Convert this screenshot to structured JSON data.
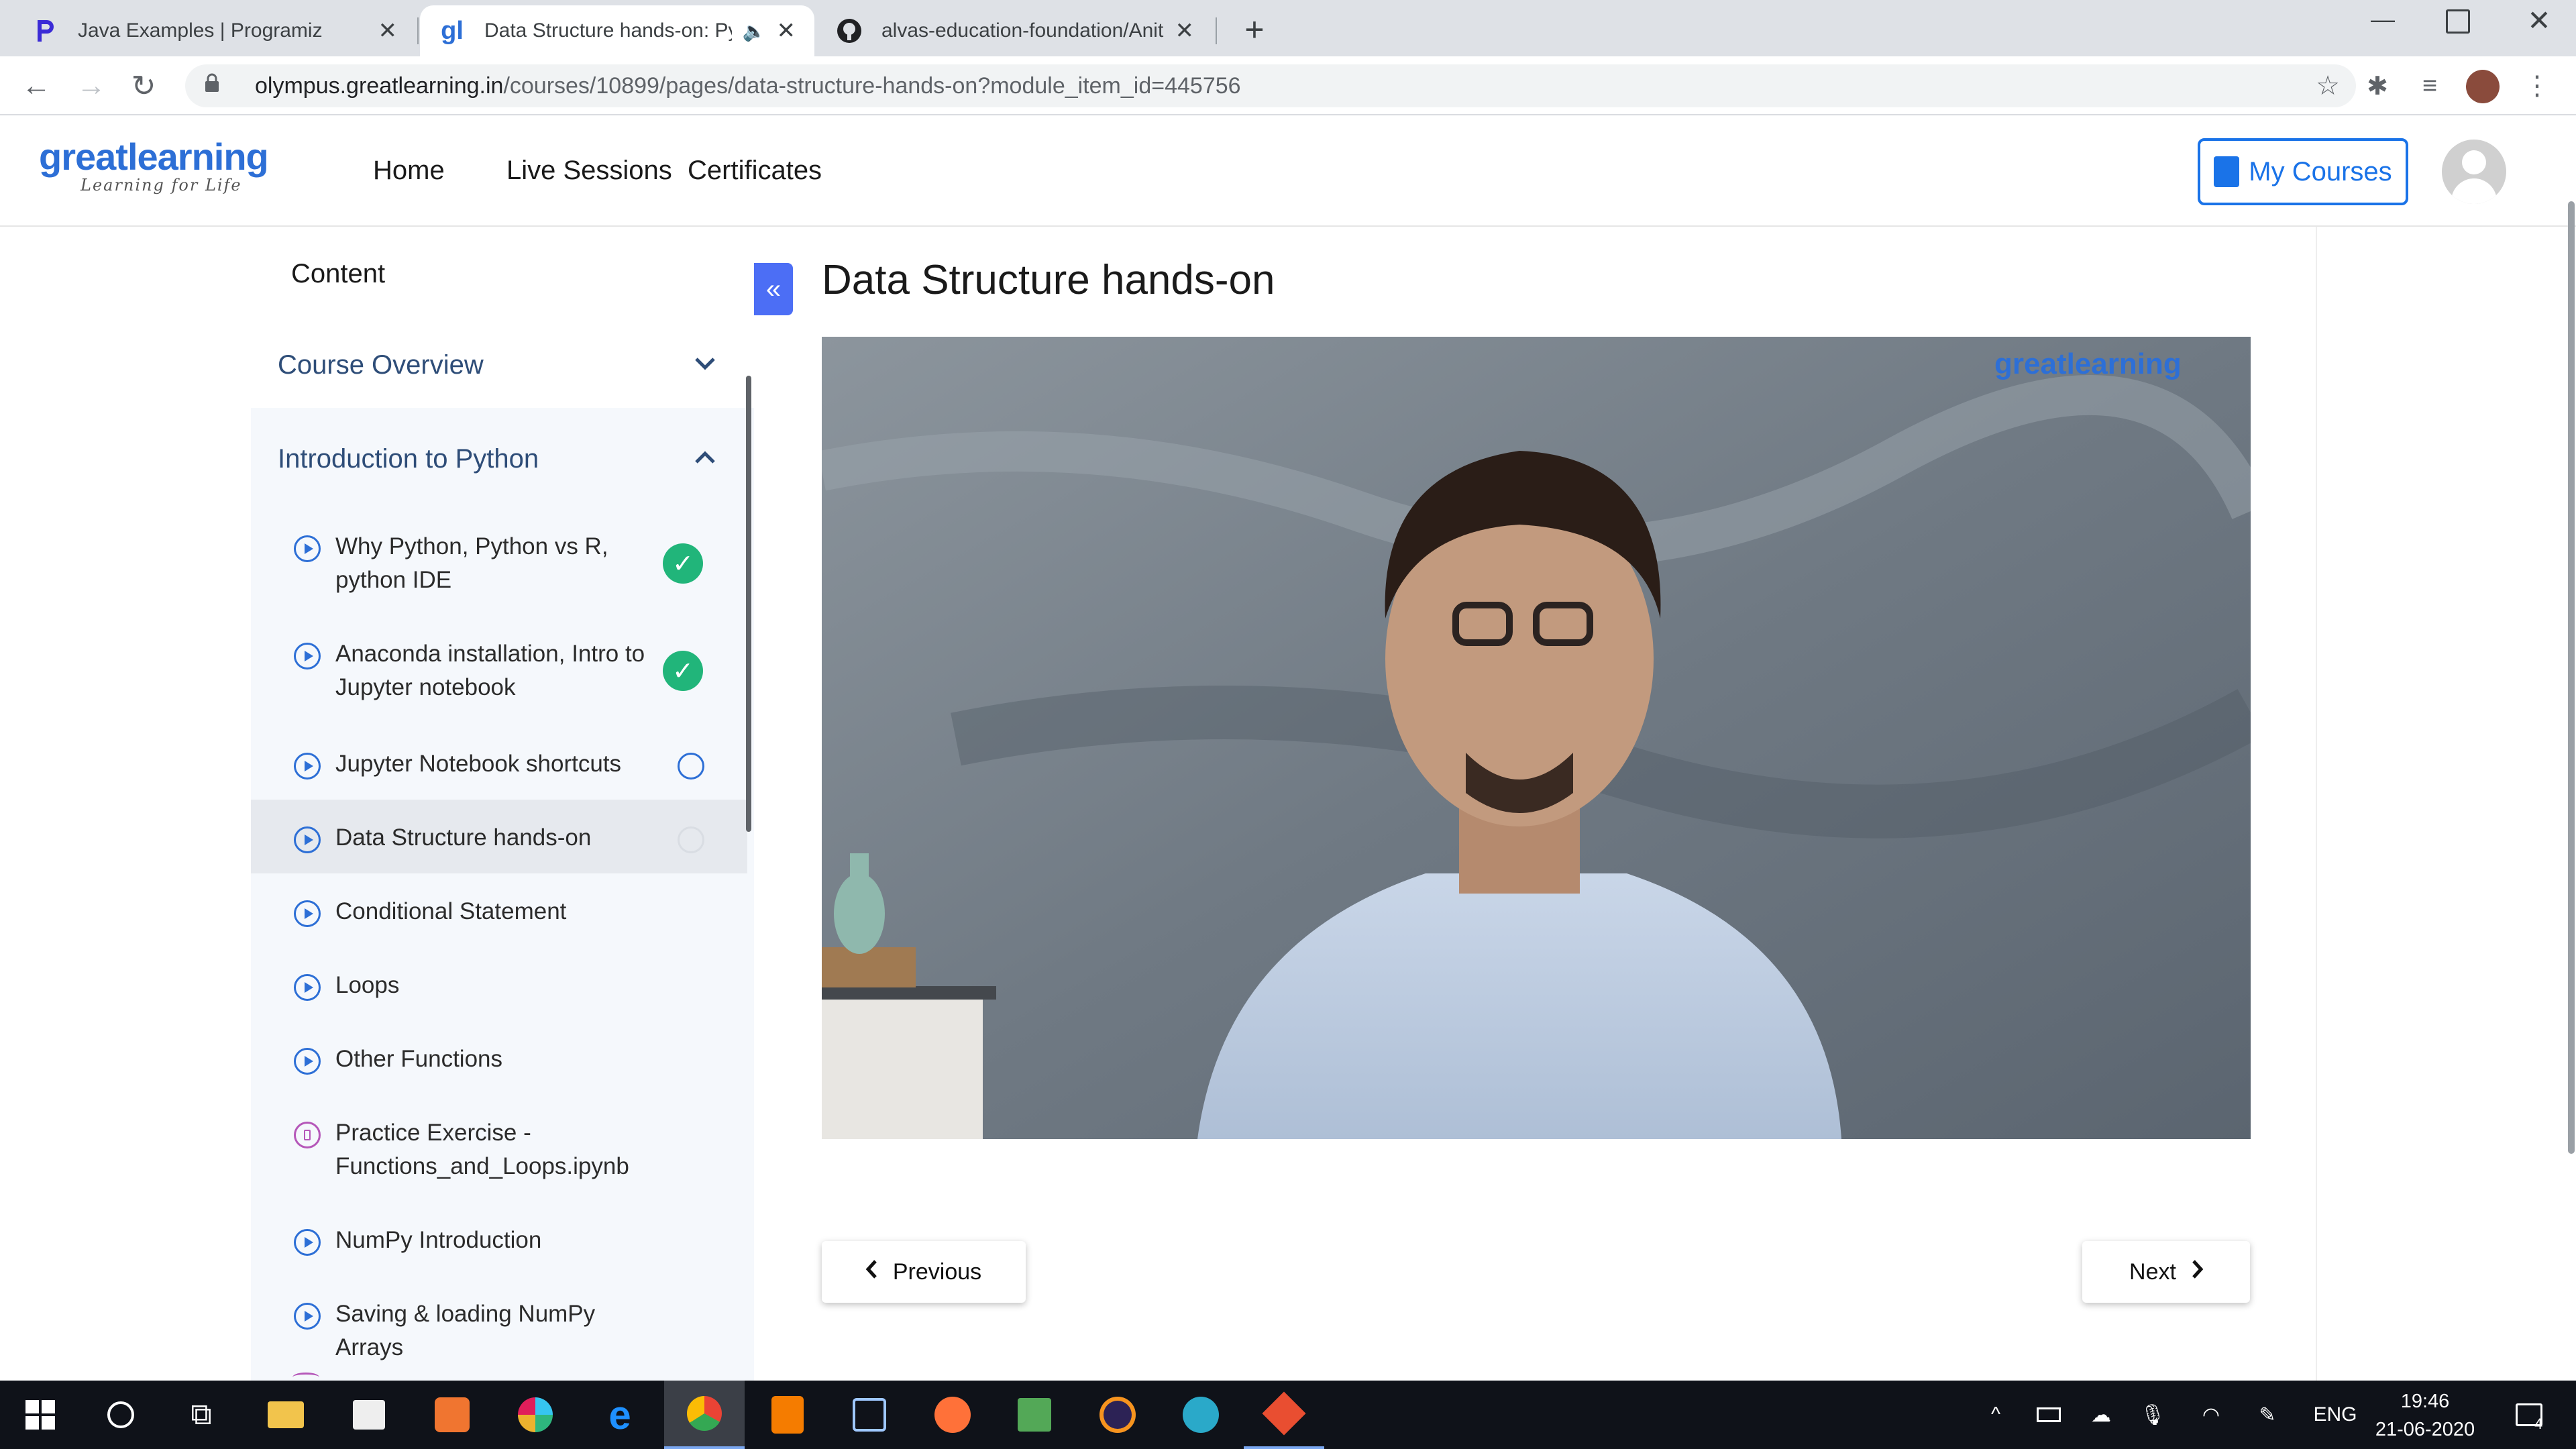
{
  "browser": {
    "tabs": [
      {
        "title": "Java Examples | Programiz",
        "favicon": "programiz-logo"
      },
      {
        "title": "Data Structure hands-on: Pyt",
        "favicon": "greatlearning-logo",
        "active": true,
        "audio": true
      },
      {
        "title": "alvas-education-foundation/Anit",
        "favicon": "github-logo"
      }
    ],
    "url_domain": "olympus.greatlearning.in",
    "url_path": "/courses/10899/pages/data-structure-hands-on?module_item_id=445756"
  },
  "site": {
    "logo_main": "greatlearning",
    "logo_tagline": "Learning for Life",
    "nav": [
      "Home",
      "Live Sessions",
      "Certificates"
    ],
    "my_courses": "My Courses"
  },
  "sidebar": {
    "heading": "Content",
    "course_overview": "Course Overview",
    "section": "Introduction to Python",
    "items": [
      {
        "label": "Why Python, Python vs R, python IDE",
        "status": "done"
      },
      {
        "label": "Anaconda installation, Intro to Jupyter notebook",
        "status": "done"
      },
      {
        "label": "Jupyter Notebook shortcuts",
        "status": "pending"
      },
      {
        "label": "Data Structure hands-on",
        "status": "current"
      },
      {
        "label": "Conditional Statement",
        "status": "none"
      },
      {
        "label": "Loops",
        "status": "none"
      },
      {
        "label": "Other Functions",
        "status": "none"
      },
      {
        "label": "Practice Exercise - Functions_and_Loops.ipynb",
        "status": "none",
        "icon": "file"
      },
      {
        "label": "NumPy Introduction",
        "status": "none"
      },
      {
        "label": "Saving & loading NumPy Arrays",
        "status": "none"
      }
    ]
  },
  "main": {
    "title": "Data Structure hands-on",
    "video_watermark": "greatlearning",
    "previous": "Previous",
    "next": "Next"
  },
  "taskbar": {
    "lang": "ENG",
    "time": "19:46",
    "date": "21-06-2020",
    "notifications": "4"
  },
  "colors": {
    "accent": "#1a73e8",
    "done": "#21b57a",
    "brand": "#2d6fd6"
  }
}
